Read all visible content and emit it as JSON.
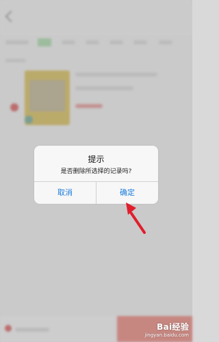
{
  "dialog": {
    "title": "提示",
    "message": "是否删除所选择的记录吗?",
    "cancel_label": "取消",
    "confirm_label": "确定"
  },
  "watermark": {
    "brand": "Bai经验",
    "url": "jingyan.baidu.com"
  },
  "colors": {
    "dialog_button": "#1a7ad9",
    "arrow": "#e01e2b",
    "background": "#d9d9d9"
  }
}
